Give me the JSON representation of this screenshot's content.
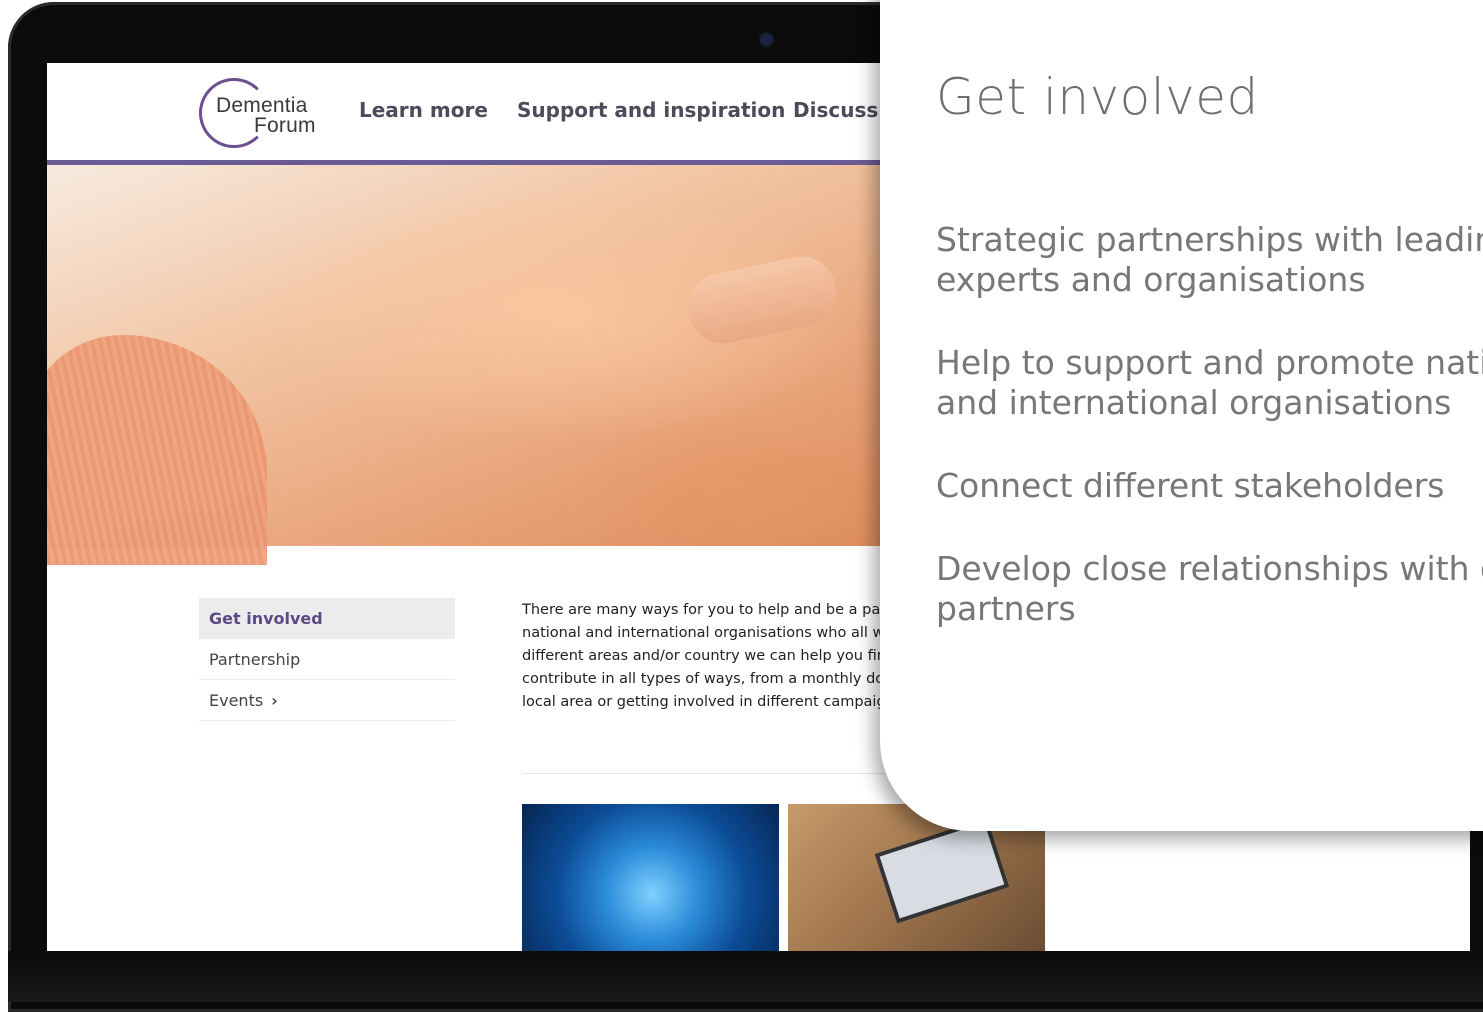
{
  "site": {
    "logo_line1": "Dementia",
    "logo_line2": "Forum",
    "nav": [
      "Learn more",
      "Support and inspiration",
      "Discuss"
    ]
  },
  "sidebar": {
    "items": [
      {
        "label": "Get involved",
        "active": true
      },
      {
        "label": "Partnership",
        "active": false
      },
      {
        "label": "Events",
        "active": false,
        "chevron": "›"
      }
    ]
  },
  "intro": {
    "lines": [
      "There are many ways for you to help and be a part",
      "national and international organisations who all wo",
      "different areas and/or country we can help you find",
      "contribute in all types of ways, from a monthly don",
      "local area or getting involved in different campaign"
    ]
  },
  "card": {
    "title": "Get involved",
    "points": [
      [
        "Strategic partnerships with leading",
        "experts and organisations"
      ],
      [
        "Help to support and promote nation",
        "and international organisations"
      ],
      [
        "Connect different stakeholders"
      ],
      [
        "Develop close relationships with our",
        "partners"
      ]
    ]
  },
  "colors": {
    "brand_purple": "#6b5b95",
    "nav_text": "#4b4b5a",
    "card_text": "#777777"
  }
}
